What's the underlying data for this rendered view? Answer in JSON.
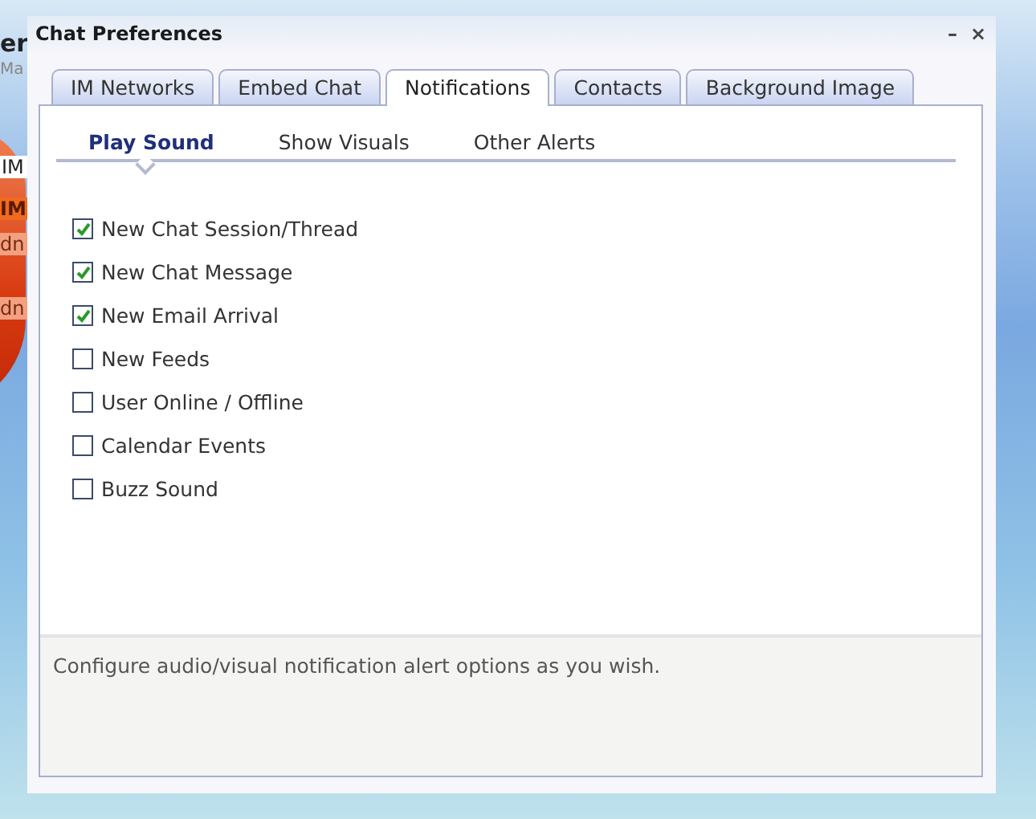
{
  "background": {
    "fragments": [
      {
        "kind": "heading",
        "text": "er"
      },
      {
        "kind": "caption",
        "text": "Ma"
      },
      {
        "kind": "field",
        "text": "IM"
      },
      {
        "kind": "bar",
        "text": "IM"
      },
      {
        "kind": "item",
        "text": "dn"
      },
      {
        "kind": "item",
        "text": "dn"
      }
    ]
  },
  "window": {
    "title": "Chat Preferences",
    "controls": [
      "–",
      "×"
    ]
  },
  "tabs": [
    {
      "label": "IM Networks",
      "selected": false
    },
    {
      "label": "Embed Chat",
      "selected": false
    },
    {
      "label": "Notifications",
      "selected": true
    },
    {
      "label": "Contacts",
      "selected": false
    },
    {
      "label": "Background Image",
      "selected": false
    }
  ],
  "subtabs": [
    {
      "label": "Play Sound",
      "selected": true
    },
    {
      "label": "Show Visuals",
      "selected": false
    },
    {
      "label": "Other Alerts",
      "selected": false
    }
  ],
  "options": [
    {
      "label": "New Chat Session/Thread",
      "checked": true
    },
    {
      "label": "New Chat Message",
      "checked": true
    },
    {
      "label": "New Email Arrival",
      "checked": true
    },
    {
      "label": "New Feeds",
      "checked": false
    },
    {
      "label": "User Online / Offline",
      "checked": false
    },
    {
      "label": "Calendar Events",
      "checked": false
    },
    {
      "label": "Buzz Sound",
      "checked": false
    }
  ],
  "footer": {
    "text": "Configure audio/visual notification alert options as you wish."
  }
}
